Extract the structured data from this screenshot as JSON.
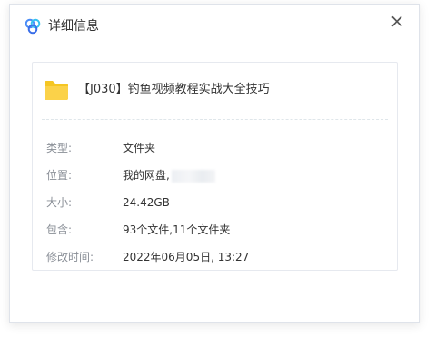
{
  "dialog": {
    "title": "详细信息",
    "close_glyph": "×"
  },
  "file": {
    "name": "【J030】钓鱼视频教程实战大全技巧",
    "icon": "folder-icon"
  },
  "details": [
    {
      "label": "类型:",
      "value": "文件夹"
    },
    {
      "label": "位置:",
      "value": "我的网盘,"
    },
    {
      "label": "大小:",
      "value": "24.42GB"
    },
    {
      "label": "包含:",
      "value": "93个文件,11个文件夹"
    },
    {
      "label": "修改时间:",
      "value": "2022年06月05日, 13:27"
    }
  ],
  "colors": {
    "folder": "#f5c623",
    "logo_blue": "#4a8cf7",
    "label": "#8a8f97",
    "text": "#333333"
  }
}
